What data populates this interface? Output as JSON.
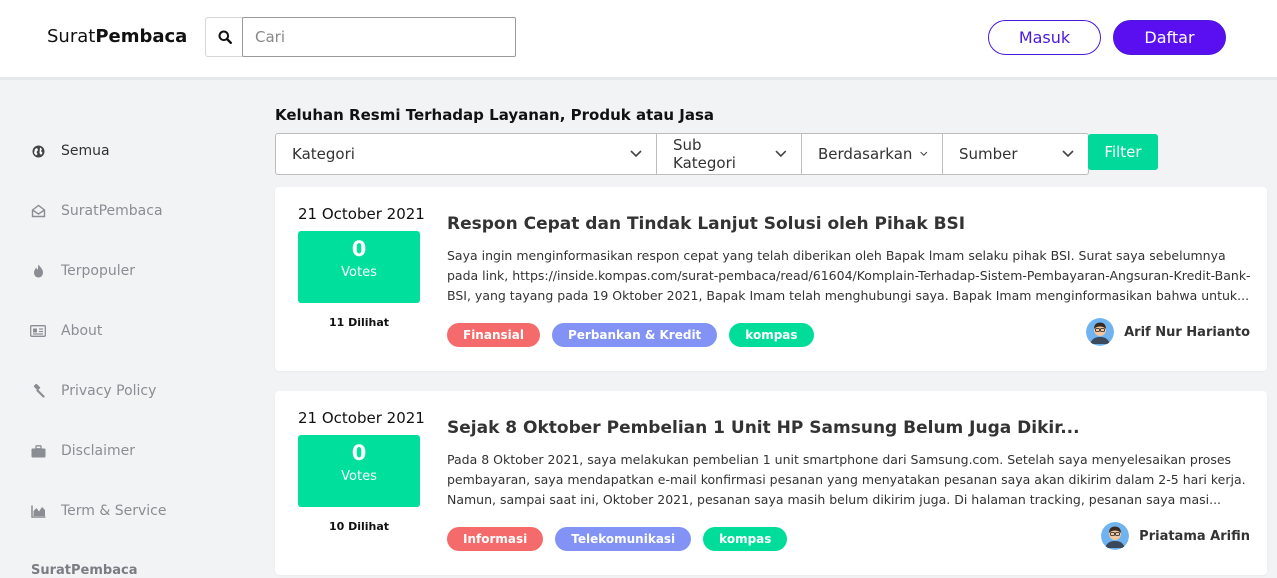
{
  "header": {
    "logo_light": "Surat",
    "logo_bold": "Pembaca",
    "search_placeholder": "Cari",
    "login_label": "Masuk",
    "register_label": "Daftar"
  },
  "sidebar": {
    "items": [
      {
        "label": "Semua",
        "icon": "globe-icon"
      },
      {
        "label": "SuratPembaca",
        "icon": "envelope-open-icon"
      },
      {
        "label": "Terpopuler",
        "icon": "fire-icon"
      },
      {
        "label": "About",
        "icon": "id-card-icon"
      },
      {
        "label": "Privacy Policy",
        "icon": "gavel-icon"
      },
      {
        "label": "Disclaimer",
        "icon": "briefcase-icon"
      },
      {
        "label": "Term & Service",
        "icon": "chart-icon"
      }
    ],
    "footer_brand": "SuratPembaca"
  },
  "main": {
    "heading": "Keluhan Resmi Terhadap Layanan, Produk atau Jasa",
    "filters": {
      "kategori": "Kategori",
      "sub_kategori": "Sub Kategori",
      "berdasarkan": "Berdasarkan",
      "sumber": "Sumber",
      "button": "Filter"
    },
    "posts": [
      {
        "date": "21 October 2021",
        "votes": "0",
        "votes_label": "Votes",
        "views": "11 Dilihat",
        "title": "Respon Cepat dan Tindak Lanjut Solusi oleh Pihak BSI",
        "excerpt": "Saya ingin menginformasikan respon cepat yang telah diberikan oleh Bapak lmam selaku pihak BSI. Surat saya sebelumnya pada link, https://inside.kompas.com/surat-pembaca/read/61604/Komplain-Terhadap-Sistem-Pembayaran-Angsuran-Kredit-Bank-BSI, yang tayang pada 19 Oktober 2021, Bapak Imam telah menghubungi saya. Bapak Imam menginformasikan bahwa untuk...",
        "tags": [
          "Finansial",
          "Perbankan & Kredit",
          "kompas"
        ],
        "author": "Arif Nur Harianto"
      },
      {
        "date": "21 October 2021",
        "votes": "0",
        "votes_label": "Votes",
        "views": "10 Dilihat",
        "title": "Sejak 8 Oktober Pembelian 1 Unit HP Samsung Belum Juga Dikir...",
        "excerpt": "Pada 8 Oktober 2021, saya melakukan pembelian 1 unit smartphone dari Samsung.com. Setelah saya menyelesaikan proses pembayaran, saya mendapatkan e-mail konfirmasi pesanan yang menyatakan pesanan saya akan dikirim dalam 2-5 hari kerja. Namun, sampai saat ini, Oktober 2021, pesanan saya masih belum dikirim juga. Di halaman tracking, pesanan saya masi...",
        "tags": [
          "Informasi",
          "Telekomunikasi",
          "kompas"
        ],
        "author": "Priatama Arifin"
      }
    ]
  },
  "colors": {
    "brand": "#5a0ff0",
    "vote_green": "#00e09c",
    "tag_red": "#f56b6b",
    "tag_blue": "#8293f5",
    "tag_green": "#00dd9a"
  }
}
